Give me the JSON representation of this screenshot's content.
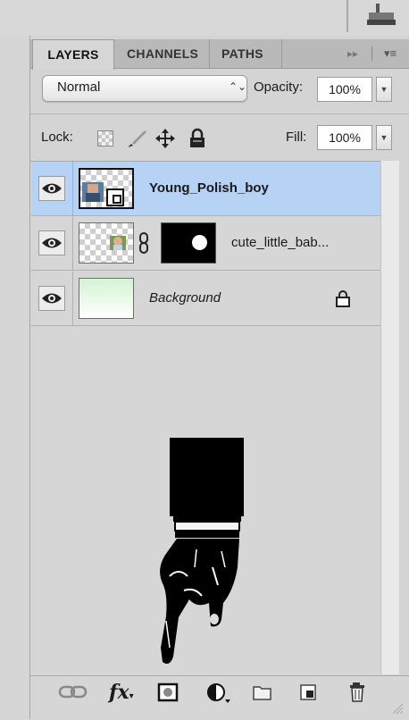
{
  "tabs": [
    {
      "label": "LAYERS",
      "active": true
    },
    {
      "label": "CHANNELS"
    },
    {
      "label": "PATHS"
    }
  ],
  "tab_controls": {
    "collapse": "▸▸",
    "menu": "▾≡"
  },
  "blend": {
    "mode": "Normal",
    "arrows": "⌃⌄",
    "opacity_label": "Opacity:",
    "opacity_value": "100%"
  },
  "lock": {
    "label": "Lock:",
    "fill_label": "Fill:",
    "fill_value": "100%"
  },
  "layers": [
    {
      "name": "Young_Polish_boy",
      "selected": true,
      "visible": true
    },
    {
      "name": "cute_little_bab...",
      "visible": true,
      "has_mask": true
    },
    {
      "name": "Background",
      "visible": true,
      "locked": true
    }
  ],
  "toolbar": [
    "link-layers-icon",
    "fx-icon",
    "add-mask-icon",
    "adjustment-layer-icon",
    "new-group-icon",
    "new-layer-icon",
    "delete-layer-icon"
  ],
  "toolbar_labels": {
    "fx": "fx"
  },
  "colors": {
    "selected_row": "#b6d2f5",
    "panel": "#d6d6d6",
    "tabbar": "#b9b9b9"
  }
}
